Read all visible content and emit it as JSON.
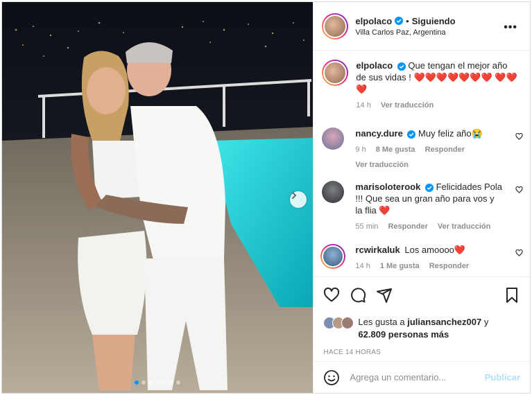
{
  "post": {
    "username": "elpolaco",
    "follow_status": "Siguiendo",
    "separator": "•",
    "location": "Villa Carlos Paz, Argentina",
    "more_label": "•••"
  },
  "caption": {
    "username": "elpolaco",
    "text": "Que tengan el mejor año de sus vidas ! ❤️❤️❤️❤️❤️❤️❤️ ❤️❤️❤️",
    "time": "14 h",
    "translate": "Ver traducción"
  },
  "comments": [
    {
      "username": "nancy.dure",
      "verified": true,
      "text": "Muy feliz año😭",
      "time": "9 h",
      "likes": "8 Me gusta",
      "reply": "Responder",
      "translate": "Ver traducción"
    },
    {
      "username": "marisoloterook",
      "verified": true,
      "text": "Felicidades Pola !!! Que sea un gran año para vos y la flia ❤️",
      "time": "55 min",
      "reply": "Responder",
      "translate": "Ver traducción"
    },
    {
      "username": "rcwirkaluk",
      "verified": false,
      "text": "Los amoooo❤️",
      "time": "14 h",
      "likes": "1 Me gusta",
      "reply": "Responder"
    }
  ],
  "likes": {
    "prefix": "Les gusta a",
    "user": "juliansanchez007",
    "middle": "y",
    "count": "62.809 personas más"
  },
  "post_time": "HACE 14 HORAS",
  "add_comment": {
    "placeholder": "Agrega un comentario...",
    "publish": "Publicar"
  },
  "carousel": {
    "slides": 7,
    "active_index": 0
  },
  "colors": {
    "verified_blue": "#0095f6",
    "publish_disabled": "#b2dffc",
    "pool": "#22c9cf"
  },
  "icons": [
    "heart-icon",
    "comment-icon",
    "share-icon",
    "bookmark-icon",
    "emoji-icon",
    "chevron-right-icon",
    "more-icon",
    "verified-icon"
  ]
}
